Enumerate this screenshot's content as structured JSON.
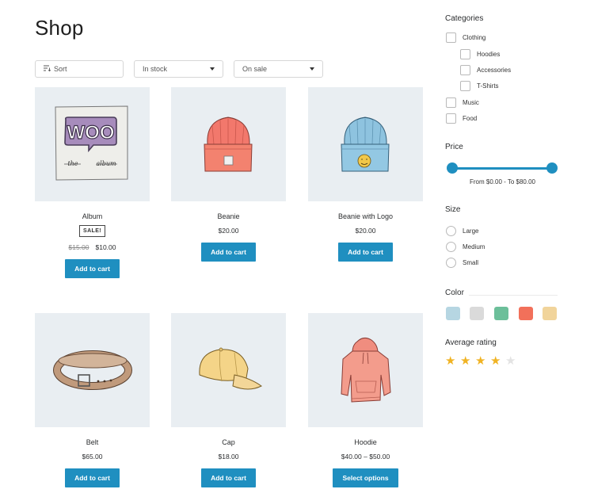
{
  "page": {
    "title": "Shop"
  },
  "filters": {
    "sort": {
      "label": "Sort",
      "icon": "sort-icon"
    },
    "stock": {
      "label": "In stock"
    },
    "sale": {
      "label": "On sale"
    }
  },
  "products": [
    {
      "name": "Album",
      "badge": "SALE!",
      "price_old": "$15.00",
      "price": "$10.00",
      "button": "Add to cart",
      "icon": "woo-album-image"
    },
    {
      "name": "Beanie",
      "price": "$20.00",
      "button": "Add to cart",
      "icon": "beanie-image"
    },
    {
      "name": "Beanie with Logo",
      "price": "$20.00",
      "button": "Add to cart",
      "icon": "beanie-logo-image"
    },
    {
      "name": "Belt",
      "price": "$65.00",
      "button": "Add to cart",
      "icon": "belt-image"
    },
    {
      "name": "Cap",
      "price": "$18.00",
      "button": "Add to cart",
      "icon": "cap-image"
    },
    {
      "name": "Hoodie",
      "price": "$40.00 – $50.00",
      "button": "Select options",
      "icon": "hoodie-image"
    }
  ],
  "album_art": {
    "logo": "WOO",
    "caption_left": "the",
    "caption_right": "album"
  },
  "sidebar": {
    "categories": {
      "title": "Categories",
      "items": [
        {
          "label": "Clothing"
        },
        {
          "label": "Hoodies"
        },
        {
          "label": "Accessories"
        },
        {
          "label": "T-Shirts"
        },
        {
          "label": "Music"
        },
        {
          "label": "Food"
        }
      ]
    },
    "price": {
      "title": "Price",
      "range_text": "From $0.00 - To $80.00",
      "min": 0,
      "max": 80,
      "selected_min": 0,
      "selected_max": 80
    },
    "size": {
      "title": "Size",
      "options": [
        {
          "label": "Large"
        },
        {
          "label": "Medium"
        },
        {
          "label": "Small"
        }
      ]
    },
    "color": {
      "title": "Color",
      "swatches": [
        "#b6d6e2",
        "#dadada",
        "#6cbf9a",
        "#f2705a",
        "#f1d49b"
      ]
    },
    "rating": {
      "title": "Average rating",
      "value": 4,
      "max": 5,
      "filled_color": "#f0b323",
      "empty_color": "#e3e3e3"
    }
  }
}
